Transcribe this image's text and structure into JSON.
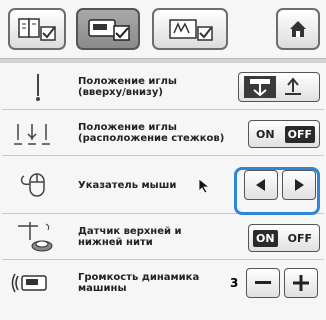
{
  "rows": [
    {
      "label": "Положение иглы\n(вверху/внизу)"
    },
    {
      "label": "Положение иглы\n(расположение стежков)",
      "on": "ON",
      "off": "OFF",
      "selected": "off"
    },
    {
      "label": "Указатель мыши"
    },
    {
      "label": "Датчик верхней и\nнижней нити",
      "on": "ON",
      "off": "OFF",
      "selected": "on"
    },
    {
      "label": "Громкость динамика\nмашины",
      "value": "3"
    }
  ],
  "icons": {
    "tab1": "book-check-icon",
    "tab2": "sewing-machine-check-icon",
    "tab3": "embroidery-check-icon",
    "home": "home-icon",
    "row1": "needle-icon",
    "row2": "needle-position-icon",
    "row3": "mouse-icon",
    "row4": "thread-sensor-icon",
    "row5": "speaker-icon"
  },
  "accent": "#2f86d6"
}
